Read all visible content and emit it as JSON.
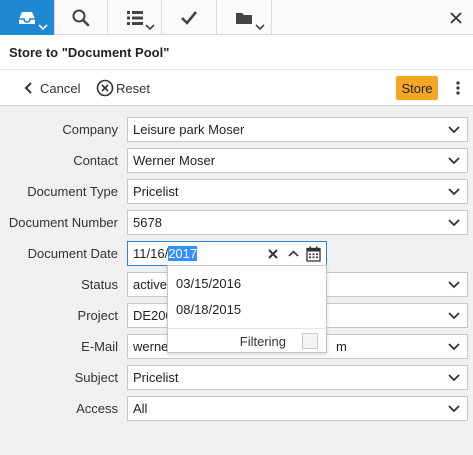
{
  "nav": {
    "tabs": [
      {
        "icon": "inbox-icon",
        "active": true
      },
      {
        "icon": "search-icon",
        "active": false
      },
      {
        "icon": "list-icon",
        "active": false
      },
      {
        "icon": "checkmark-icon",
        "active": false
      },
      {
        "icon": "folder-icon",
        "active": false
      }
    ],
    "close_icon": "close-icon",
    "accent": "#1e88d2"
  },
  "title": "Store to \"Document Pool\"",
  "toolbar": {
    "cancel_label": "Cancel",
    "reset_label": "Reset",
    "store_label": "Store",
    "store_color": "#f5a623"
  },
  "form": {
    "fields": [
      {
        "label": "Company",
        "value": "Leisure park Moser"
      },
      {
        "label": "Contact",
        "value": "Werner Moser"
      },
      {
        "label": "Document Type",
        "value": "Pricelist"
      },
      {
        "label": "Document Number",
        "value": "5678"
      },
      {
        "label": "Document Date",
        "value_prefix": "11/16/",
        "value_selected": "2017"
      },
      {
        "label": "Status",
        "value": "active"
      },
      {
        "label": "Project",
        "value": "DE200"
      },
      {
        "label": "E-Mail",
        "value_left": "werne",
        "value_right": "m"
      },
      {
        "label": "Subject",
        "value": "Pricelist"
      },
      {
        "label": "Access",
        "value": "All"
      }
    ]
  },
  "date_popup": {
    "options": [
      "03/15/2016",
      "08/18/2015"
    ],
    "filter_label": "Filtering",
    "filter_checked": false
  }
}
